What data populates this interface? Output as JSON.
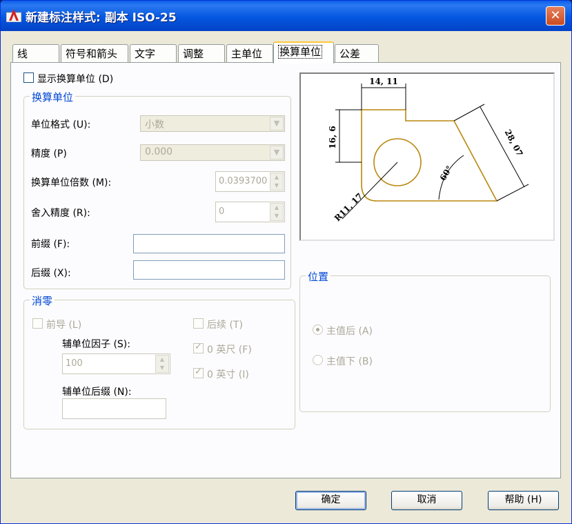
{
  "window": {
    "title": "新建标注样式: 副本 ISO-25",
    "close_label": "✕"
  },
  "tabs": [
    {
      "label": "线"
    },
    {
      "label": "符号和箭头"
    },
    {
      "label": "文字"
    },
    {
      "label": "调整"
    },
    {
      "label": "主单位"
    },
    {
      "label": "换算单位",
      "active": true
    },
    {
      "label": "公差"
    }
  ],
  "display_alt_units": {
    "label": "显示换算单位 (D)",
    "checked": false
  },
  "alt_units": {
    "title": "换算单位",
    "unit_format": {
      "label": "单位格式 (U):",
      "value": "小数"
    },
    "precision": {
      "label": "精度 (P)",
      "value": "0.000"
    },
    "multiplier": {
      "label": "换算单位倍数 (M):",
      "value": "0.0393700"
    },
    "round_off": {
      "label": "舍入精度 (R):",
      "value": "0"
    },
    "prefix": {
      "label": "前缀 (F):",
      "value": ""
    },
    "suffix": {
      "label": "后缀 (X):",
      "value": ""
    }
  },
  "zero_suppression": {
    "title": "消零",
    "leading": {
      "label": "前导 (L)",
      "checked": false
    },
    "sub_unit_factor": {
      "label": "辅单位因子 (S):",
      "value": "100"
    },
    "sub_unit_suffix": {
      "label": "辅单位后缀 (N):",
      "value": ""
    },
    "trailing": {
      "label": "后续 (T)",
      "checked": false
    },
    "feet": {
      "label": "0 英尺 (F)",
      "checked": true
    },
    "inches": {
      "label": "0 英寸 (I)",
      "checked": true
    }
  },
  "placement": {
    "title": "位置",
    "after_primary": {
      "label": "主值后 (A)",
      "checked": true
    },
    "below_primary": {
      "label": "主值下 (B)",
      "checked": false
    }
  },
  "preview": {
    "dim_top": "14, 11",
    "dim_left": "16, 6",
    "dim_right": "28, 07",
    "dim_angle": "60°",
    "dim_radius": "R11, 17",
    "line_color": "#b8860b"
  },
  "buttons": {
    "ok": "确定",
    "cancel": "取消",
    "help": "帮助 (H)"
  },
  "colors": {
    "title_bar": "#0a5ee9",
    "group_title": "#0046d5",
    "close": "#d9552c"
  }
}
